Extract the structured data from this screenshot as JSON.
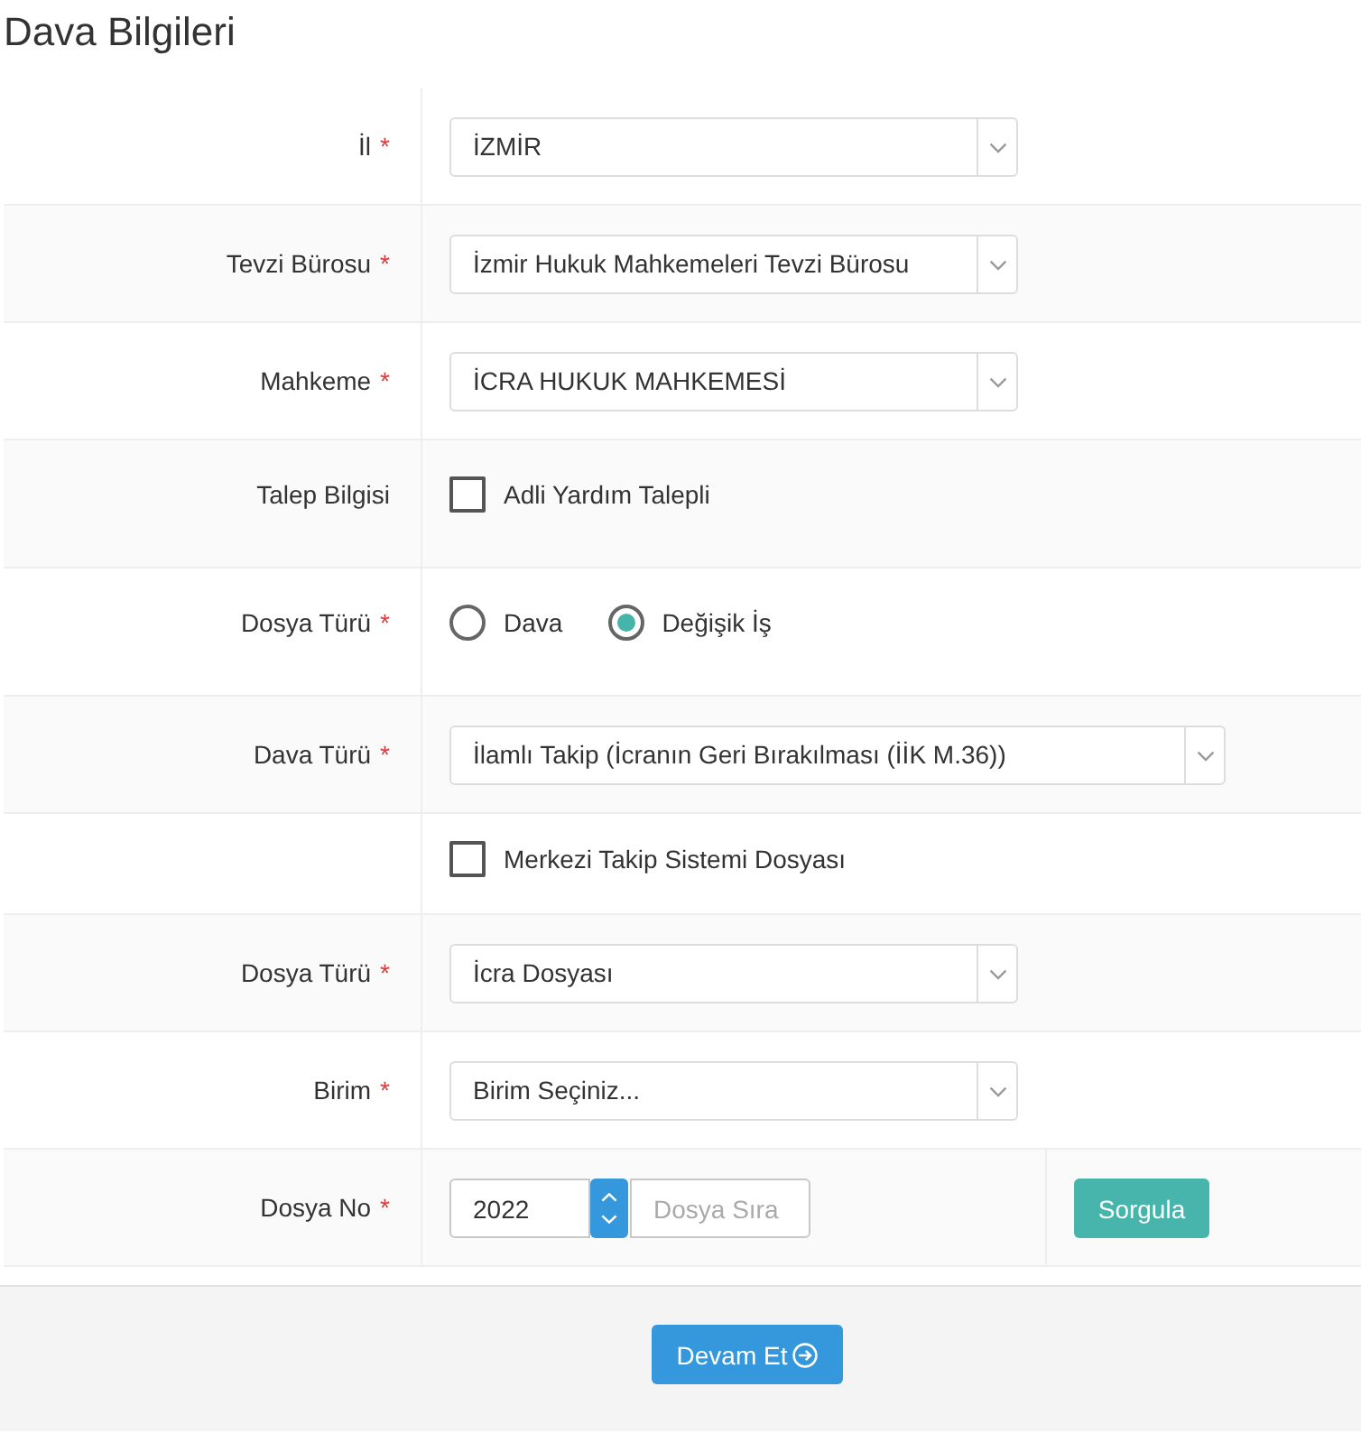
{
  "title": "Dava Bilgileri",
  "rows": [
    {
      "kind": "select",
      "label": "İl",
      "required_mark": "*",
      "value": "İZMİR",
      "wide": false
    },
    {
      "kind": "select",
      "label": "Tevzi Bürosu",
      "required_mark": "*",
      "value": "İzmir Hukuk Mahkemeleri Tevzi Bürosu",
      "wide": false
    },
    {
      "kind": "select",
      "label": "Mahkeme",
      "required_mark": "*",
      "value": "İCRA HUKUK MAHKEMESİ",
      "wide": false
    },
    {
      "kind": "checkbox",
      "label": "Talep Bilgisi",
      "option": "Adli Yardım Talepli",
      "checked": false
    },
    {
      "kind": "radio",
      "label": "Dosya Türü",
      "required_mark": "*",
      "options": [
        {
          "label": "Dava",
          "selected": false
        },
        {
          "label": "Değişik İş",
          "selected": true
        }
      ]
    },
    {
      "kind": "select",
      "label": "Dava Türü",
      "required_mark": "*",
      "value": "İlamlı Takip (İcranın Geri Bırakılması (İİK M.36))",
      "wide": true
    },
    {
      "kind": "checkbox",
      "option": "Merkezi Takip Sistemi Dosyası",
      "checked": false
    },
    {
      "kind": "select",
      "label": "Dosya Türü",
      "required_mark": "*",
      "value": "İcra Dosyası",
      "wide": false
    },
    {
      "kind": "select",
      "label": "Birim",
      "required_mark": "*",
      "value": "Birim Seçiniz...",
      "wide": false
    },
    {
      "kind": "file-number",
      "label": "Dosya No",
      "required_mark": "*",
      "year": "2022",
      "placeholder": "Dosya Sıra",
      "button": "Sorgula"
    }
  ],
  "footer": {
    "button": "Devam Et"
  }
}
